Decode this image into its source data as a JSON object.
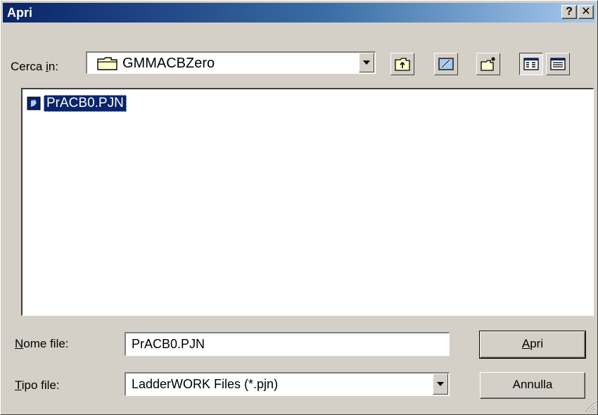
{
  "window": {
    "title": "Apri",
    "help_label": "?",
    "close_label": "✕"
  },
  "lookin": {
    "label_prefix": "Cerca ",
    "label_accel": "i",
    "label_suffix": "n:",
    "value": "GMMACBZero"
  },
  "toolbar": {
    "icons": [
      "folder-up-icon",
      "desktop-icon",
      "new-folder-icon",
      "list-view-icon",
      "details-view-icon"
    ]
  },
  "files": [
    {
      "name": "PrACB0.PJN",
      "selected": true
    }
  ],
  "filename": {
    "label_accel": "N",
    "label_rest": "ome file:",
    "value": "PrACB0.PJN"
  },
  "filetype": {
    "label_accel": "T",
    "label_rest": "ipo file:",
    "value": "LadderWORK Files (*.pjn)"
  },
  "buttons": {
    "open_accel": "A",
    "open_rest": "pri",
    "cancel": "Annulla"
  },
  "colors": {
    "title_start": "#0a246a",
    "title_end": "#a6caf0",
    "face": "#d4d0c8",
    "selection": "#0a246a"
  }
}
